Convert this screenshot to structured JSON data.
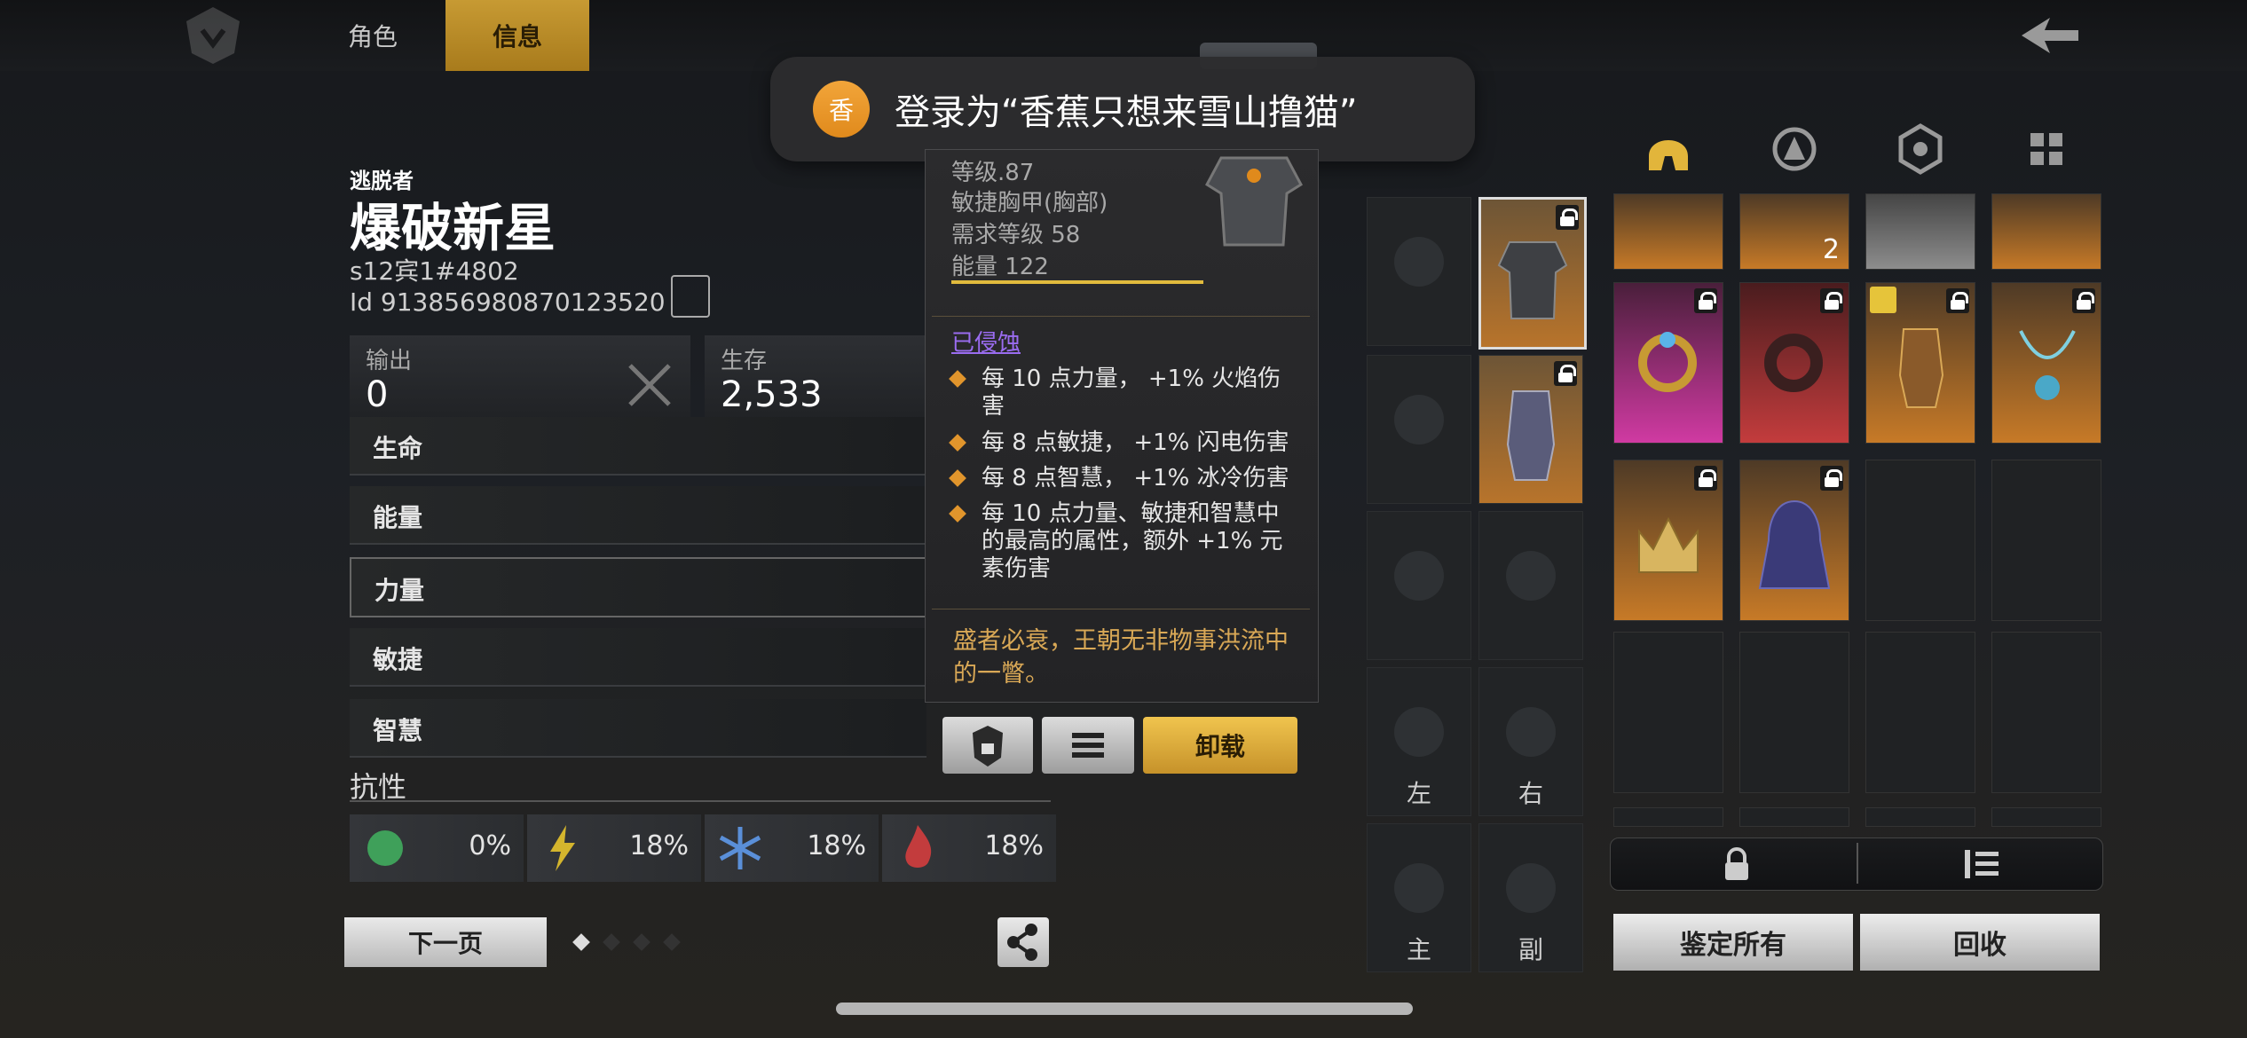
{
  "tabs": {
    "role": "角色",
    "info": "信息"
  },
  "toast": {
    "avatar_char": "香",
    "text": "登录为“香蕉只想来雪山撸猫”"
  },
  "character": {
    "class": "逃脱者",
    "name": "爆破新星",
    "server": "s12宾1#4802",
    "id": "Id 913856980870123520"
  },
  "stats": {
    "output_label": "输出",
    "output_value": "0",
    "survival_label": "生存",
    "survival_value": "2,533"
  },
  "attributes": [
    "生命",
    "能量",
    "力量",
    "敏捷",
    "智慧"
  ],
  "resistance": {
    "title": "抗性",
    "values": [
      "0%",
      "18%",
      "18%",
      "18%"
    ],
    "colors": [
      "#3fa05a",
      "#d4b52d",
      "#5a8fd8",
      "#c33c3d"
    ]
  },
  "pager": {
    "next_label": "下一页",
    "pages": 4,
    "current": 1
  },
  "tooltip": {
    "level": "等级.87",
    "type": "敏捷胸甲(胸部)",
    "req_level": "需求等级 58",
    "energy": "能量 122",
    "corrupted": "已侵蚀",
    "affixes": [
      "每 10 点力量， +1% 火焰伤害",
      "每 8 点敏捷， +1% 闪电伤害",
      "每 8 点智慧， +1% 冰冷伤害",
      "每 10 点力量、敏捷和智慧中的最高的属性，额外 +1% 元素伤害"
    ],
    "flavor": "盛者必衰，王朝无非物事洪流中的一瞥。",
    "unequip_label": "卸载"
  },
  "equip_slots": {
    "left": "左",
    "right": "右",
    "main": "主",
    "off": "副"
  },
  "inventory": {
    "top_row_count": "2",
    "identify_label": "鉴定所有",
    "recycle_label": "回收"
  },
  "colors": {
    "accent": "#c79a33",
    "corrupt": "#9a6cf0",
    "flavor": "#d9a856"
  }
}
